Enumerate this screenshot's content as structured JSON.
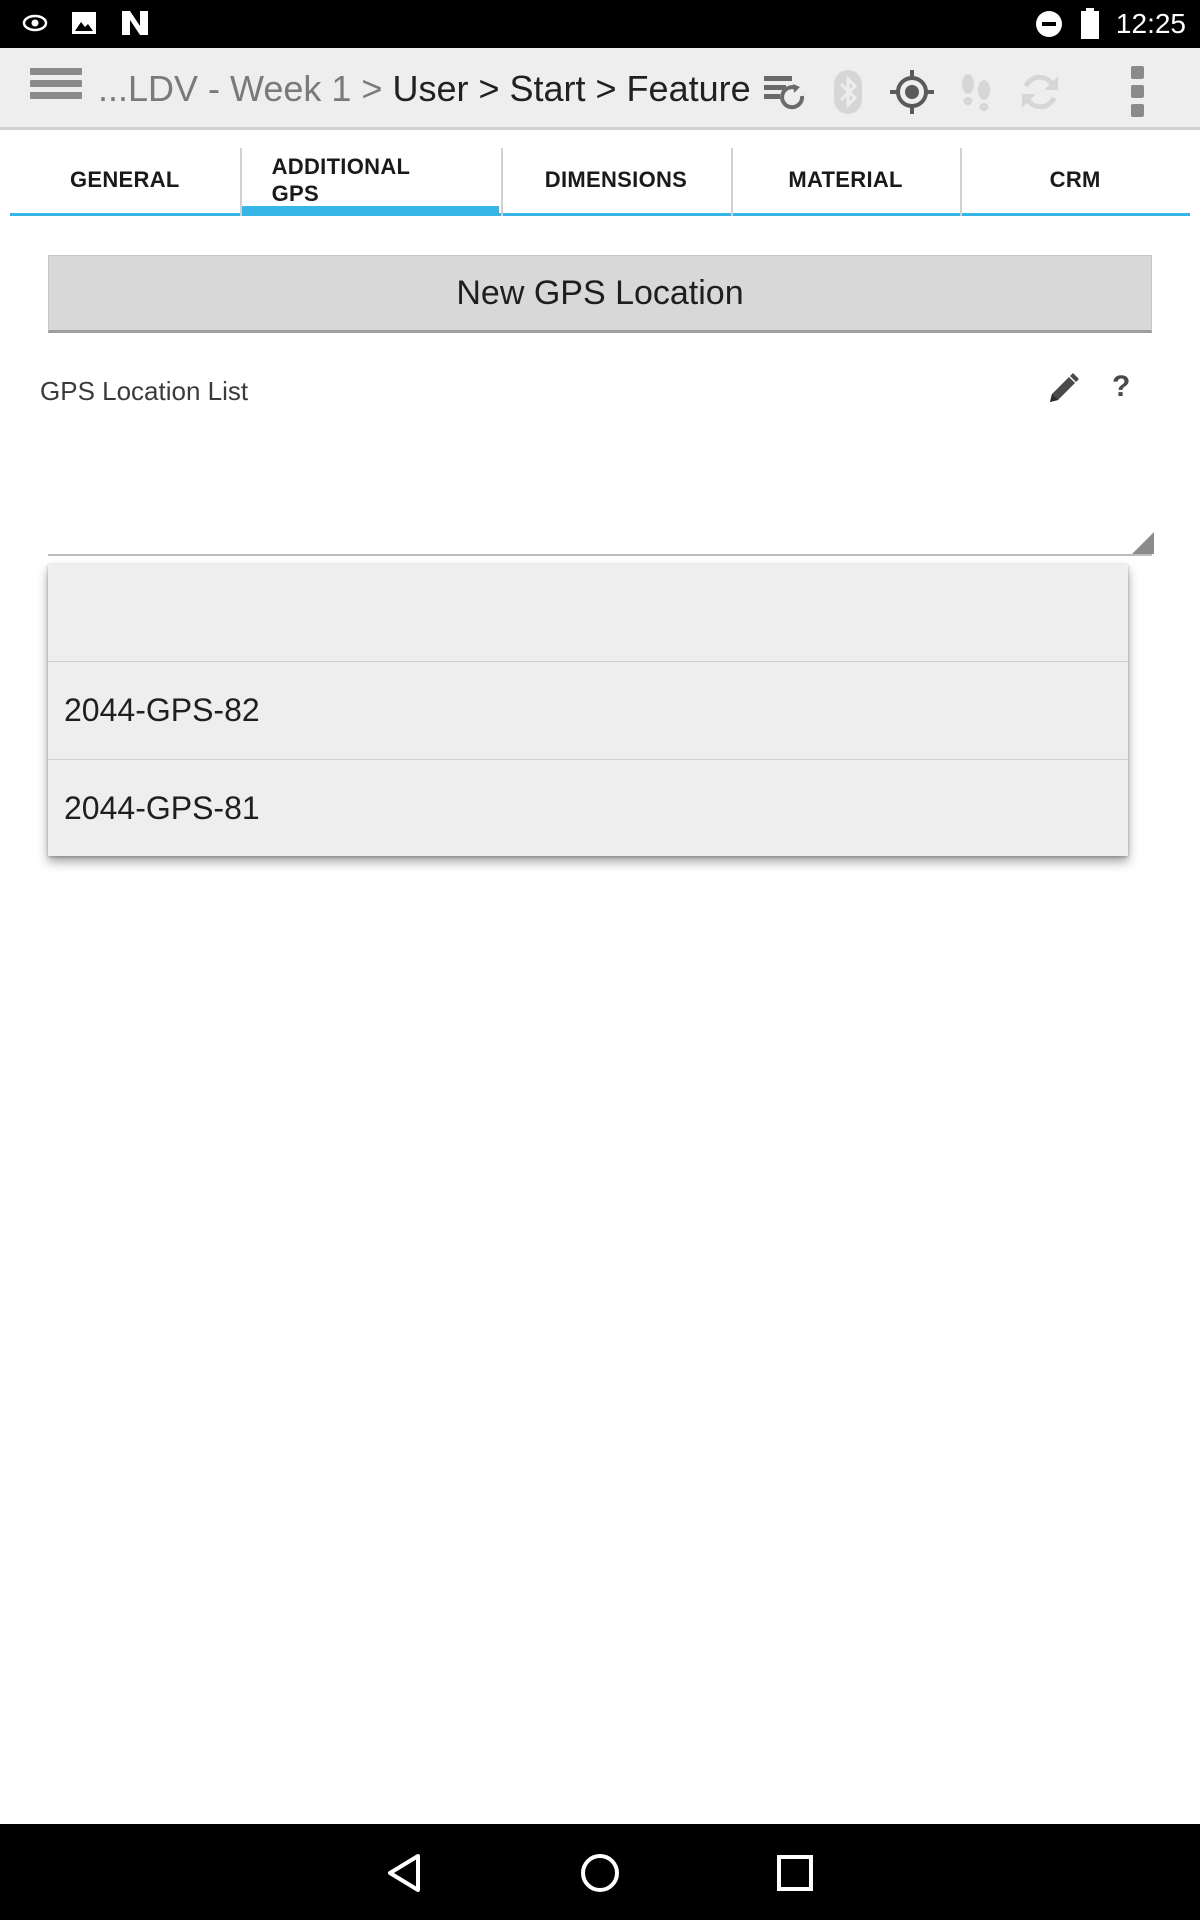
{
  "status_bar": {
    "time": "12:25",
    "icons": [
      "eye-notification-icon",
      "image-notification-icon",
      "n-notification-icon",
      "do-not-disturb-icon",
      "battery-icon"
    ]
  },
  "app_bar": {
    "breadcrumb_dim": "...LDV - Week 1 >",
    "breadcrumb_active": "User > Start > Feature",
    "icons": [
      "menu-icon",
      "sync-list-icon",
      "bluetooth-icon",
      "gps-target-icon",
      "footsteps-icon",
      "refresh-icon",
      "overflow-menu-icon"
    ]
  },
  "tabs": [
    {
      "label": "GENERAL",
      "active": false
    },
    {
      "label": "ADDITIONAL GPS",
      "active": true
    },
    {
      "label": "DIMENSIONS",
      "active": false
    },
    {
      "label": "MATERIAL",
      "active": false
    },
    {
      "label": "CRM",
      "active": false
    }
  ],
  "main": {
    "new_button_label": "New GPS Location",
    "list_label": "GPS Location List",
    "help_symbol": "?",
    "dropdown_items": [
      "",
      "2044-GPS-82",
      "2044-GPS-81"
    ]
  },
  "colors": {
    "accent": "#35b6e6",
    "app_bar_bg": "#eeeeee",
    "button_bg": "#d8d8d8"
  }
}
